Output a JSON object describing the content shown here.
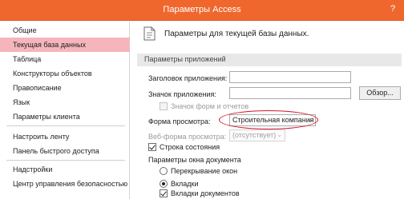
{
  "window": {
    "title": "Параметры Access",
    "help_glyph": "?"
  },
  "sidebar": {
    "items": [
      {
        "label": "Общие",
        "active": false
      },
      {
        "label": "Текущая база данных",
        "active": true
      },
      {
        "label": "Таблица",
        "active": false
      },
      {
        "label": "Конструкторы объектов",
        "active": false
      },
      {
        "label": "Правописание",
        "active": false
      },
      {
        "label": "Язык",
        "active": false
      },
      {
        "label": "Параметры клиента",
        "active": false
      },
      {
        "label": "Настроить ленту",
        "active": false
      },
      {
        "label": "Панель быстрого доступа",
        "active": false
      },
      {
        "label": "Надстройки",
        "active": false
      },
      {
        "label": "Центр управления безопасностью",
        "active": false
      }
    ]
  },
  "main": {
    "header": "Параметры для текущей базы данных.",
    "section_title": "Параметры приложений",
    "app_title_label": "Заголовок приложения:",
    "app_title_value": "",
    "app_icon_label": "Значок приложения:",
    "app_icon_value": "",
    "browse_button": "Обзор...",
    "forms_reports_icon_label": "Значок форм и отчетов",
    "display_form_label": "Форма просмотра:",
    "display_form_value": "Строительная компания",
    "web_form_label": "Веб-форма просмотра:",
    "web_form_value": "(отсутствует)",
    "status_bar_label": "Строка состояния",
    "doc_window_options_label": "Параметры окна документа",
    "overlapping_windows_label": "Перекрывание окон",
    "tabs_label": "Вкладки",
    "doc_tabs_label": "Вкладки документов",
    "dropdown_glyph": "⌄"
  },
  "colors": {
    "titlebar": "#f0672e",
    "active_item": "#f5b5bb",
    "annotation": "#d3142b"
  }
}
